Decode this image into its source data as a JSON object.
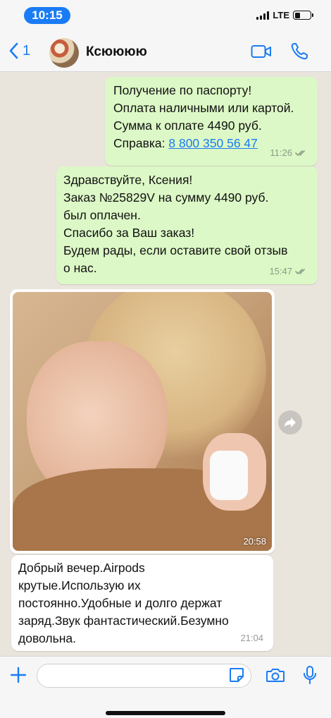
{
  "status_bar": {
    "time": "10:15",
    "network": "LTE"
  },
  "nav": {
    "back_count": "1",
    "contact_name": "Ксюююю"
  },
  "messages": [
    {
      "lines": [
        "Получение по паспорту!",
        "Оплата наличными или картой.",
        "Сумма к оплате 4490 руб."
      ],
      "ref_prefix": "Справка: ",
      "ref_link": "8 800 350 56 47",
      "time": "11:26"
    },
    {
      "lines": [
        "Здравствуйте, Ксения!",
        "Заказ №25829V на сумму 4490 руб.",
        "был оплачен.",
        "Спасибо за Ваш заказ!",
        "Будем рады, если оставите свой отзыв",
        "о нас."
      ],
      "time": "15:47"
    },
    {
      "type": "photo",
      "time": "20:58"
    },
    {
      "lines": [
        "Добрый вечер.Airpods",
        "крутые.Использую их",
        "постоянно.Удобные и долго держат",
        "заряд.Звук фантастический.Безумно",
        "довольна."
      ],
      "time": "21:04"
    }
  ],
  "colors": {
    "accent": "#1a7cf5",
    "outgoing": "#dcf8c6",
    "incoming": "#ffffff"
  }
}
